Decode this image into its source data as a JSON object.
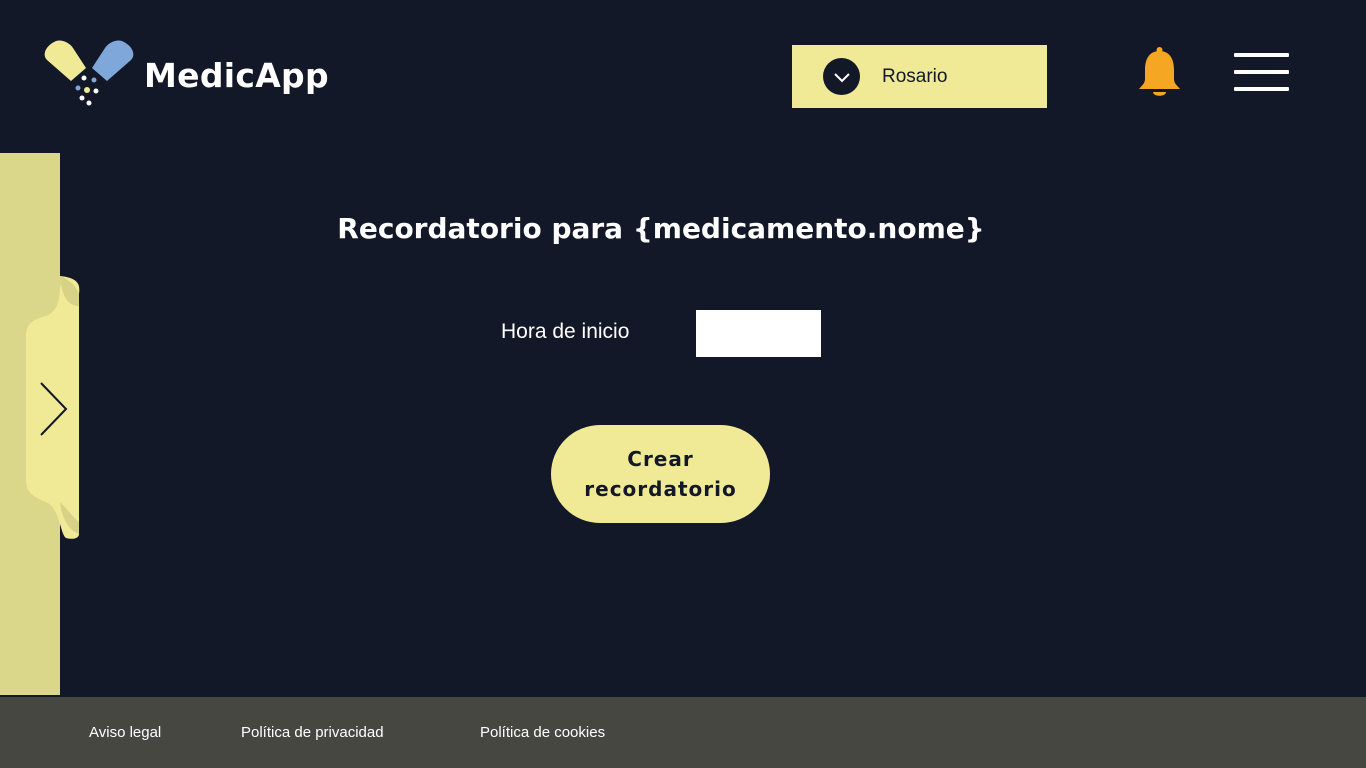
{
  "header": {
    "brand": "MedicApp",
    "user_selector": {
      "selected": "Rosario"
    }
  },
  "main": {
    "title": "Recordatorio para {medicamento.nome}",
    "start_time_label": "Hora de inicio",
    "start_time_value": "",
    "create_button": "Crear recordatorio"
  },
  "footer": {
    "links": [
      "Aviso legal",
      "Política de privacidad",
      "Política de cookies"
    ]
  },
  "icons": {
    "logo": "pill-capsule-logo",
    "user_dropdown": "chevron-down-icon",
    "notifications": "bell-icon",
    "menu": "hamburger-menu-icon",
    "side_panel_toggle": "chevron-right-icon"
  },
  "colors": {
    "background": "#121828",
    "accent": "#F0EA96",
    "side_panel": "#DAD78A",
    "bell": "#F5A623",
    "footer": "#464740",
    "logo_yellow": "#F0EA96",
    "logo_blue": "#7FA7D9"
  }
}
